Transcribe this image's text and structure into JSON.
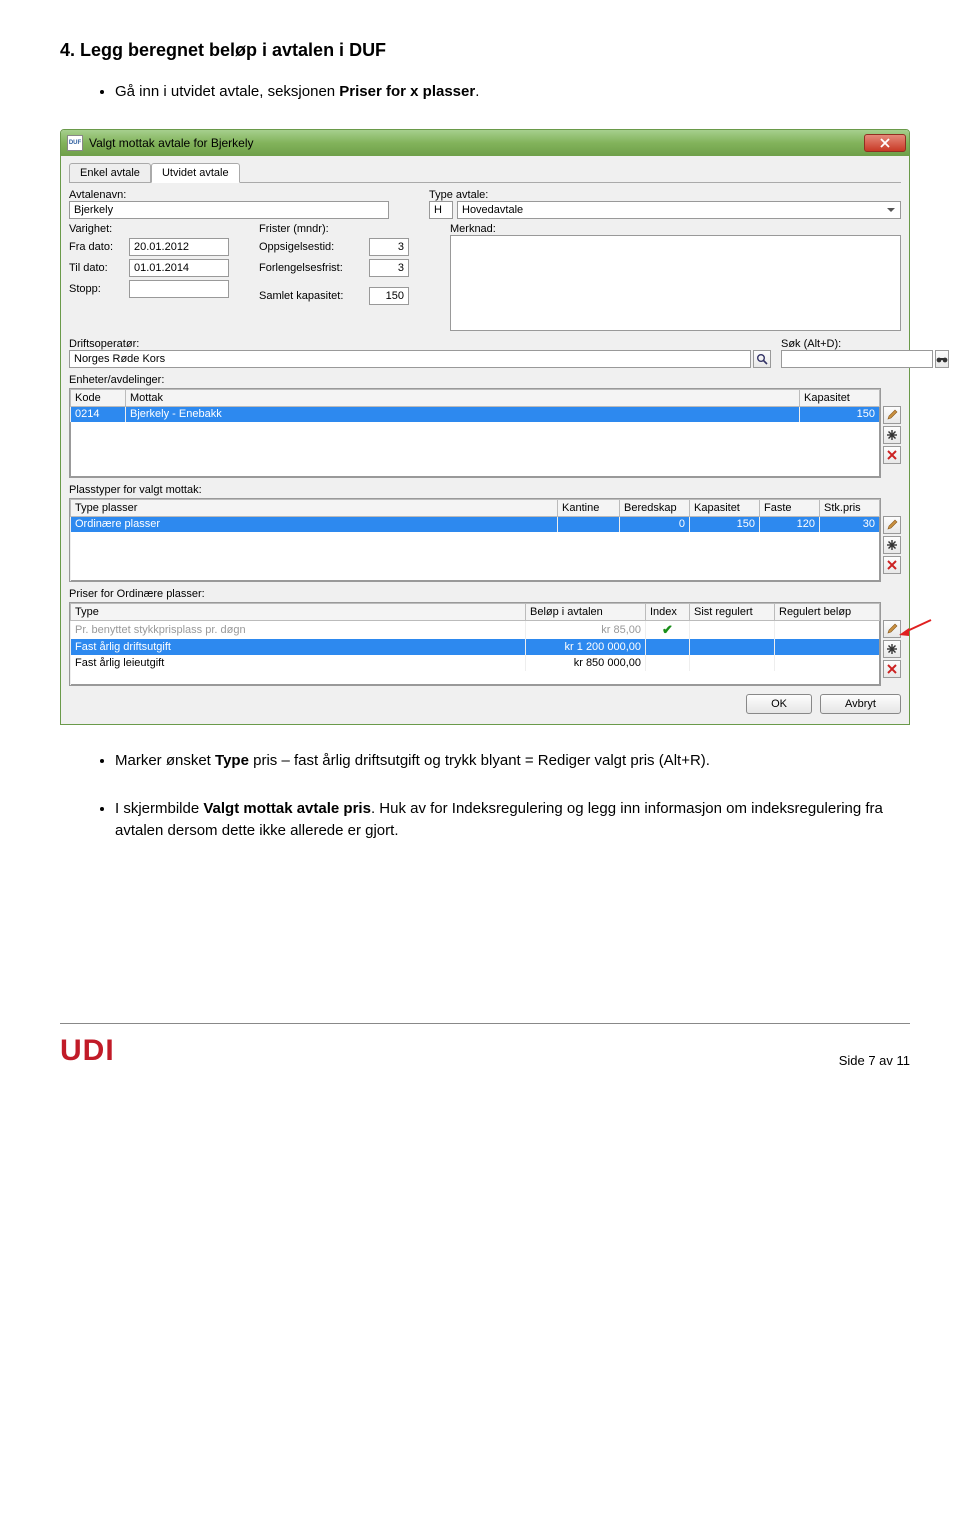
{
  "doc": {
    "heading": "4. Legg beregnet beløp i avtalen i DUF",
    "bullets": [
      {
        "pre": "Gå inn i utvidet avtale, seksjonen ",
        "bold": "Priser for x plasser",
        "post": "."
      }
    ],
    "bullets2": [
      {
        "pre": "Marker ønsket ",
        "bold": "Type",
        "post": " pris – fast årlig driftsutgift og trykk blyant = Rediger valgt pris (Alt+R)."
      }
    ],
    "bullets3": [
      {
        "pre": "I skjermbilde ",
        "bold": "Valgt mottak avtale pris",
        "post": ". Huk av for Indeksregulering og legg inn informasjon om indeksregulering fra avtalen dersom dette ikke allerede er gjort."
      }
    ],
    "footer_logo": "UDI",
    "page_no": "Side 7 av 11"
  },
  "win": {
    "title": "Valgt mottak avtale for Bjerkely",
    "app_icon_text": "DUF",
    "tabs": {
      "t1": "Enkel avtale",
      "t2": "Utvidet avtale"
    },
    "labels": {
      "avtalenavn": "Avtalenavn:",
      "type_avtale": "Type avtale:",
      "varighet": "Varighet:",
      "frister": "Frister (mndr):",
      "merknad": "Merknad:",
      "fra_dato": "Fra dato:",
      "til_dato": "Til dato:",
      "stopp": "Stopp:",
      "oppsigelsestid": "Oppsigelsestid:",
      "forlengelsesfrist": "Forlengelsesfrist:",
      "samlet_kapasitet": "Samlet kapasitet:",
      "driftsoperator": "Driftsoperatør:",
      "sok": "Søk (Alt+D):",
      "enheter": "Enheter/avdelinger:",
      "plasstyper": "Plasstyper for valgt mottak:",
      "priser_for": "Priser for Ordinære plasser:"
    },
    "values": {
      "avtalenavn": "Bjerkely",
      "type_code": "H",
      "type_name": "Hovedavtale",
      "fra_dato": "20.01.2012",
      "til_dato": "01.01.2014",
      "stopp": "",
      "oppsigelsestid": "3",
      "forlengelsesfrist": "3",
      "samlet_kapasitet": "150",
      "driftsoperator": "Norges Røde Kors",
      "sok": ""
    },
    "enheter": {
      "headers": {
        "kode": "Kode",
        "mottak": "Mottak",
        "kapasitet": "Kapasitet"
      },
      "rows": [
        {
          "kode": "0214",
          "mottak": "Bjerkely - Enebakk",
          "kapasitet": "150"
        }
      ]
    },
    "plasstyper": {
      "headers": {
        "type_plasser": "Type plasser",
        "kantine": "Kantine",
        "beredskap": "Beredskap",
        "kapasitet": "Kapasitet",
        "faste": "Faste",
        "stk_pris": "Stk.pris"
      },
      "rows": [
        {
          "type": "Ordinære plasser",
          "kantine": "",
          "beredskap": "0",
          "kapasitet": "150",
          "faste": "120",
          "stk": "30"
        }
      ]
    },
    "priser": {
      "headers": {
        "type": "Type",
        "belop": "Beløp i avtalen",
        "index": "Index",
        "sist_regulert": "Sist regulert",
        "regulert_belop": "Regulert beløp"
      },
      "rows": [
        {
          "type": "Pr. benyttet stykkprisplass pr. døgn",
          "belop": "kr 85,00",
          "index_check": true,
          "sist": "",
          "reg": ""
        },
        {
          "type": "Fast årlig driftsutgift",
          "belop": "kr 1 200 000,00",
          "index_check": false,
          "sist": "",
          "reg": ""
        },
        {
          "type": "Fast årlig leieutgift",
          "belop": "kr 850 000,00",
          "index_check": false,
          "sist": "",
          "reg": ""
        }
      ]
    },
    "buttons": {
      "ok": "OK",
      "avbryt": "Avbryt"
    }
  }
}
